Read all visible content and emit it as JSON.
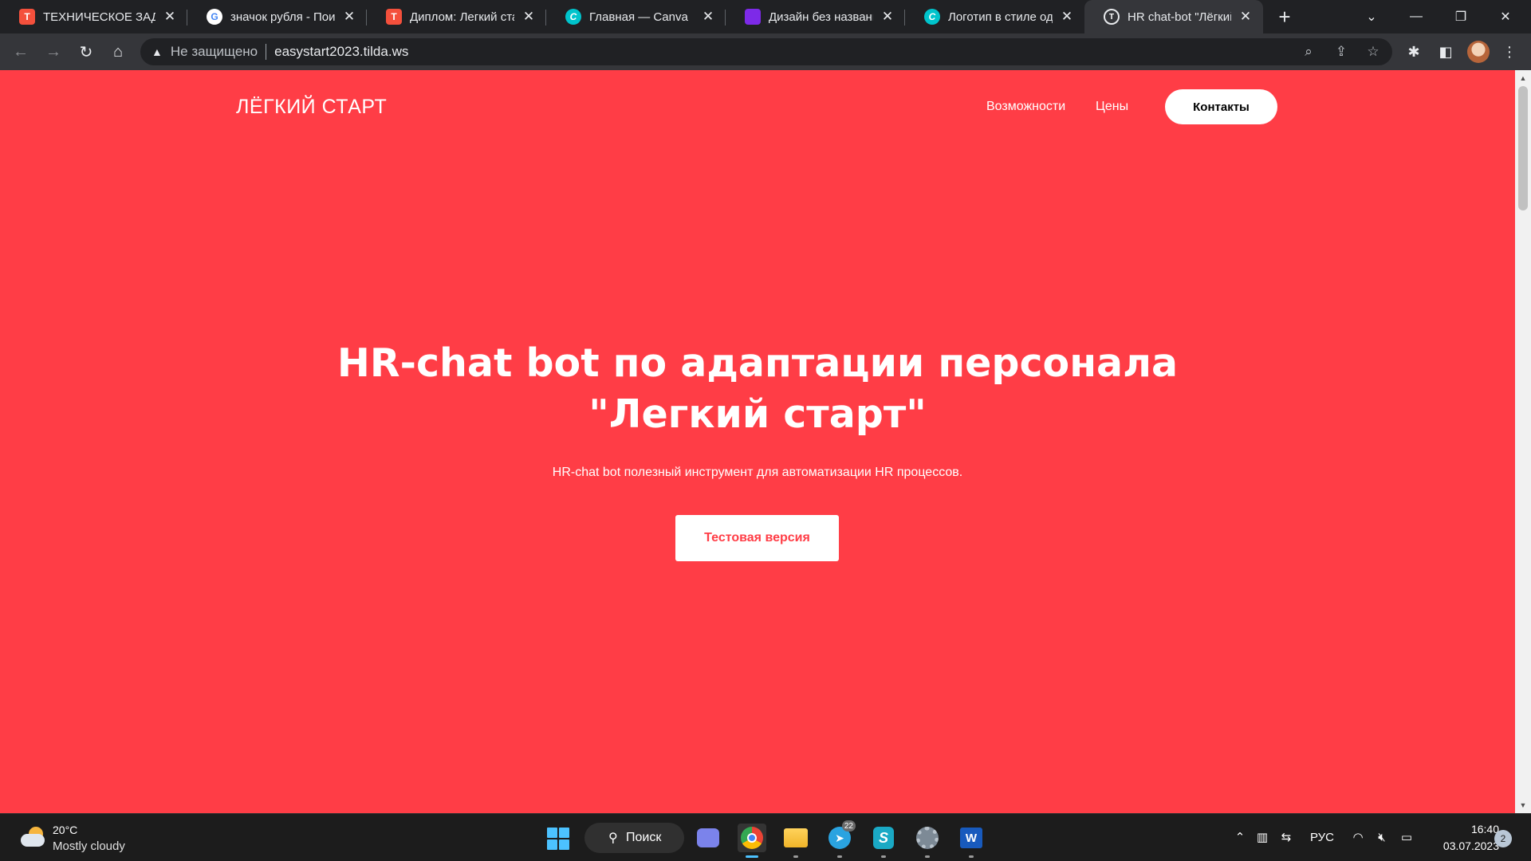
{
  "browser": {
    "tabs": [
      {
        "title": "ТЕХНИЧЕСКОЕ ЗАДАНИЕ",
        "icon": "tilda-favicon-icon",
        "favicon_text": "T"
      },
      {
        "title": "значок рубля - Поиск",
        "icon": "google-favicon-icon",
        "favicon_text": "G"
      },
      {
        "title": "Диплом: Легкий старт",
        "icon": "tilda-favicon-icon",
        "favicon_text": "T"
      },
      {
        "title": "Главная — Canva",
        "icon": "canva-favicon-icon",
        "favicon_text": "C"
      },
      {
        "title": "Дизайн без названия",
        "icon": "canva-design-favicon-icon",
        "favicon_text": ""
      },
      {
        "title": "Логотип в стиле одного",
        "icon": "canva-favicon-icon",
        "favicon_text": "C"
      },
      {
        "title": "HR chat-bot \"Лёгкий старт\"",
        "icon": "tilda-site-favicon-icon",
        "favicon_text": "T",
        "active": true
      }
    ],
    "close_glyph": "✕",
    "new_tab_glyph": "+",
    "address_bar": {
      "security_label": "Не защищено",
      "url": "easystart2023.tilda.ws"
    }
  },
  "site": {
    "logo": "ЛЁГКИЙ СТАРТ",
    "nav": [
      "Возможности",
      "Цены"
    ],
    "contacts_button": "Контакты",
    "hero": {
      "title_line1": "HR-chat bot по адаптации персонала",
      "title_line2": "\"Легкий старт\"",
      "subtitle": "HR-chat bot полезный инструмент для автоматизации HR процессов.",
      "button": "Тестовая версия"
    },
    "accent_color": "#ff3d46"
  },
  "taskbar": {
    "weather": {
      "temp": "20°C",
      "condition": "Mostly cloudy"
    },
    "search_label": "Поиск",
    "telegram_badge": "22",
    "word_label": "W",
    "skype_label": "S",
    "language": "РУС",
    "time": "16:40",
    "date": "03.07.2023",
    "notification_count": "2"
  }
}
